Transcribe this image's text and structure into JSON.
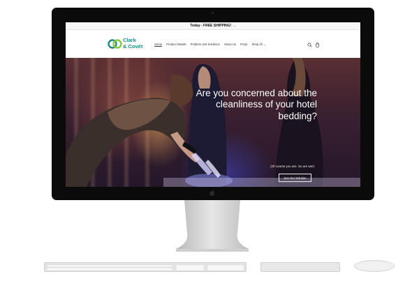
{
  "announcement": {
    "text": "Today - FREE SHIPPING!",
    "arrow": "→"
  },
  "brand": {
    "line1": "Clark",
    "line2": "& Covét",
    "color": "#1e8a8a",
    "accent": "#8cc63f"
  },
  "nav": {
    "items": [
      {
        "label": "Home",
        "active": true
      },
      {
        "label": "Product Details"
      },
      {
        "label": "Problem and Solutions"
      },
      {
        "label": "About Us"
      },
      {
        "label": "FAQs"
      },
      {
        "label": "Shop All"
      }
    ],
    "shop_chevron": "⌄"
  },
  "header_icons": [
    "search-icon",
    "cart-icon"
  ],
  "hero": {
    "heading": "Are you concerned about the cleanliness of your hotel bedding?",
    "subheading": "(Of course you are. So are we!)",
    "button_label": "See Our Solution"
  },
  "device": {
    "brand_logo": "apple-logo-icon"
  }
}
